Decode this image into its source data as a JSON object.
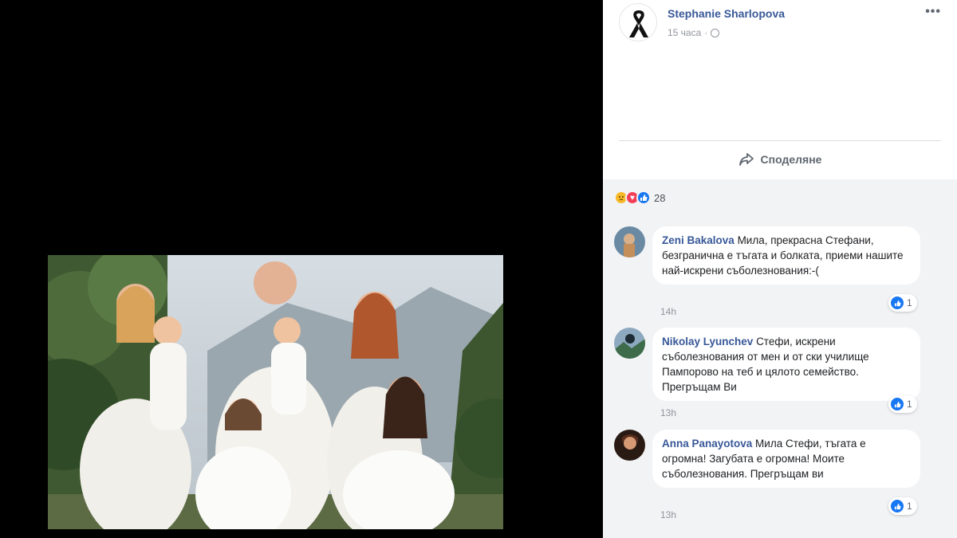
{
  "post": {
    "author": "Stephanie Sharlopova",
    "time": "15 часа",
    "more_icon": "more-options-icon",
    "share_label": "Споделяне"
  },
  "reactions": {
    "icons": [
      "sad-reaction-icon",
      "love-reaction-icon",
      "like-reaction-icon"
    ],
    "count": "28"
  },
  "comments": [
    {
      "author": "Zeni Bakalova",
      "text": "Мила, прекрасна Стефани, безгранична е тъгата и болката, приеми нашите най-искрени съболезнования:-(",
      "time": "14h",
      "likes": "1"
    },
    {
      "author": "Nikolay Lyunchev",
      "text": "Стефи, искрени съболезнования от мен и от ски училище Пампорово на теб и цялото семейство. Прегръщам Ви",
      "time": "13h",
      "likes": "1"
    },
    {
      "author": "Anna Panayotova",
      "text": "Мила Стефи, тъгата е огромна! Загубата е огромна! Моите съболезнования. Прегръщам ви",
      "time": "13h",
      "likes": "1"
    }
  ]
}
